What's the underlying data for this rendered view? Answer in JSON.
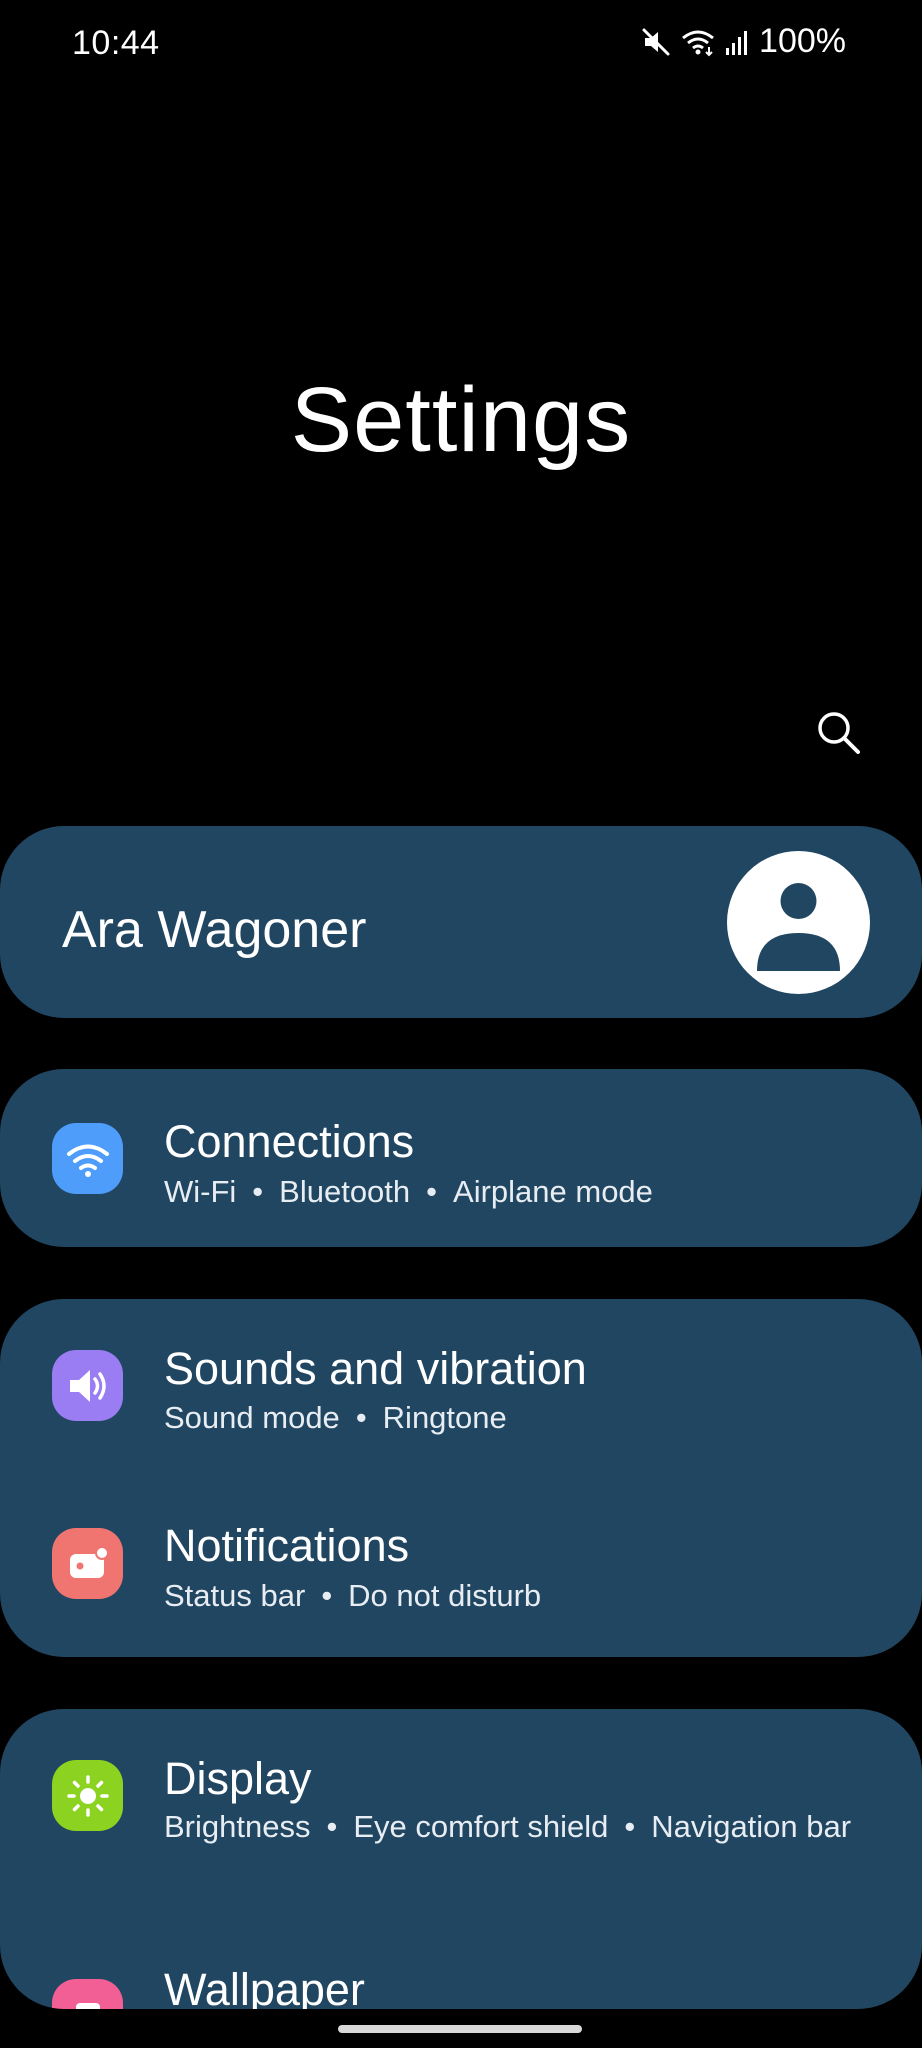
{
  "status_bar": {
    "time": "10:44",
    "battery": "100%",
    "icons": [
      "mute-icon",
      "wifi-icon",
      "signal-icon"
    ]
  },
  "page": {
    "title": "Settings"
  },
  "search": {
    "icon": "search-icon"
  },
  "account": {
    "name": "Ara Wagoner",
    "avatar_icon": "person-icon"
  },
  "settings": [
    {
      "title": "Connections",
      "subtitle_parts": [
        "Wi-Fi",
        "Bluetooth",
        "Airplane mode"
      ],
      "icon": "wifi-icon",
      "color": "#4f9dfb"
    },
    {
      "title": "Sounds and vibration",
      "subtitle_parts": [
        "Sound mode",
        "Ringtone"
      ],
      "icon": "speaker-icon",
      "color": "#9a7cf3"
    },
    {
      "title": "Notifications",
      "subtitle_parts": [
        "Status bar",
        "Do not disturb"
      ],
      "icon": "notification-icon",
      "color": "#f07570"
    },
    {
      "title": "Display",
      "subtitle_parts": [
        "Brightness",
        "Eye comfort shield",
        "Navigation bar"
      ],
      "icon": "sun-icon",
      "color": "#8bd320"
    },
    {
      "title": "Wallpaper",
      "subtitle_parts": [],
      "icon": "wallpaper-icon",
      "color": "#f25f95"
    }
  ],
  "colors": {
    "background": "#000000",
    "card": "#214661",
    "text": "#ffffff"
  }
}
